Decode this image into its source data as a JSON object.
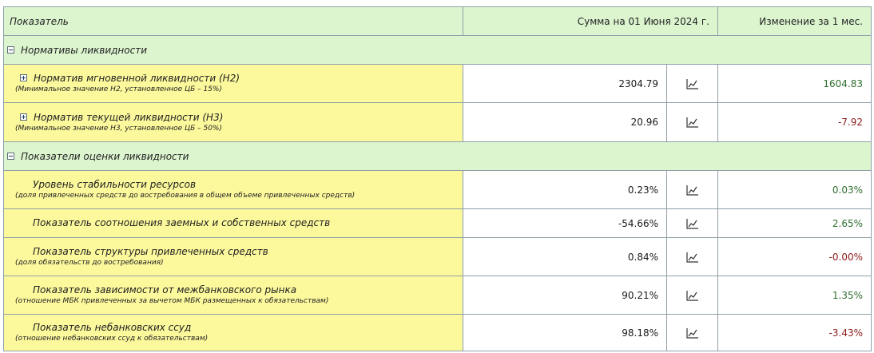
{
  "header": {
    "col_name": "Показатель",
    "col_sum": "Сумма на 01 Июня 2024 г.",
    "col_change": "Изменение за 1 мес."
  },
  "sections": [
    {
      "title": "Нормативы ликвидности",
      "rows": [
        {
          "title": "Норматив мгновенной ликвидности (Н2)",
          "subtitle": "(Минимальное значение Н2, установленное ЦБ – 15%)",
          "value": "2304.79",
          "change": "1604.83"
        },
        {
          "title": "Норматив текущей ликвидности (Н3)",
          "subtitle": "(Минимальное значение Н3, установленное ЦБ – 50%)",
          "value": "20.96",
          "change": "-7.92"
        }
      ]
    },
    {
      "title": "Показатели оценки ликвидности",
      "rows": [
        {
          "title": "Уровень стабильности ресурсов",
          "subtitle": "(доля привлеченных средств до востребования в общем объеме привлеченных средств)",
          "value": "0.23%",
          "change": "0.03%"
        },
        {
          "title": "Показатель соотношения заемных и собственных средств",
          "subtitle": "",
          "value": "-54.66%",
          "change": "2.65%"
        },
        {
          "title": "Показатель структуры привлеченных средств",
          "subtitle": "(доля обязательств до востребования)",
          "value": "0.84%",
          "change": "-0.00%"
        },
        {
          "title": "Показатель зависимости от межбанковского рынка",
          "subtitle": "(отношение МБК привлеченных за вычетом МБК размещенных к обязательствам)",
          "value": "90.21%",
          "change": "1.35%"
        },
        {
          "title": "Показатель небанковских ссуд",
          "subtitle": "(отношение небанковских ссуд к обязательствам)",
          "value": "98.18%",
          "change": "-3.43%"
        }
      ]
    }
  ],
  "icons": {
    "toggle_collapse": "minus-box-icon",
    "toggle_expand": "plus-box-icon",
    "chart": "line-chart-icon"
  },
  "colors": {
    "header_bg": "#dcf5cf",
    "name_bg": "#fcf89c",
    "positive": "#2e6e2e",
    "negative": "#8a1a1a",
    "border": "#8f9fa8"
  }
}
